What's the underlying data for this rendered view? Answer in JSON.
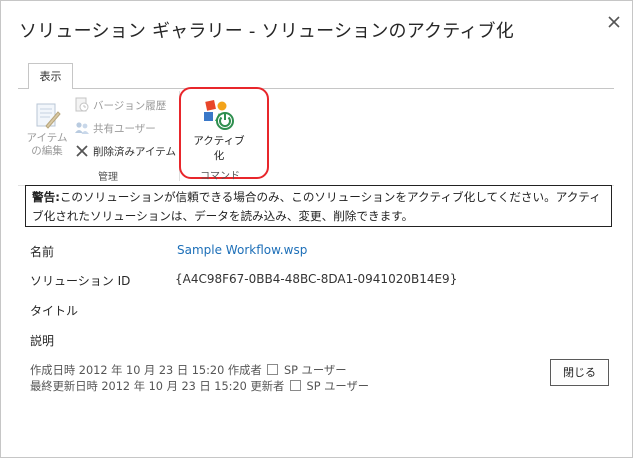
{
  "dialog": {
    "title": "ソリューション ギャラリー - ソリューションのアクティブ化",
    "close_icon": "close-icon"
  },
  "ribbon": {
    "tab_label": "表示",
    "manage_group": {
      "label": "管理",
      "edit_item_label_line1": "アイテム",
      "edit_item_label_line2": "の編集",
      "version_history_label": "バージョン履歴",
      "shared_users_label": "共有ユーザー",
      "delete_item_label": "削除済みアイテム"
    },
    "command_group": {
      "label": "コマンド",
      "activate_label": "アクティブ化"
    }
  },
  "warning": {
    "prefix": "警告:",
    "text": "このソリューションが信頼できる場合のみ、このソリューションをアクティブ化してください。アクティブ化されたソリューションは、データを読み込み、変更、削除できます。"
  },
  "fields": {
    "name_label": "名前",
    "name_value": "Sample Workflow.wsp",
    "solution_id_label": "ソリューション ID",
    "solution_id_value": "{A4C98F67-0BB4-48BC-8DA1-0941020B14E9}",
    "title_label": "タイトル",
    "description_label": "説明"
  },
  "meta": {
    "created_prefix": "作成日時 2012 年 10 月 23 日 15:20 作成者",
    "created_user": "SP ユーザー",
    "modified_prefix": "最終更新日時 2012 年 10 月 23 日 15:20 更新者",
    "modified_user": "SP ユーザー"
  },
  "buttons": {
    "close_label": "閉じる"
  },
  "colors": {
    "link": "#1d6fb8",
    "highlight": "#e8262b"
  }
}
